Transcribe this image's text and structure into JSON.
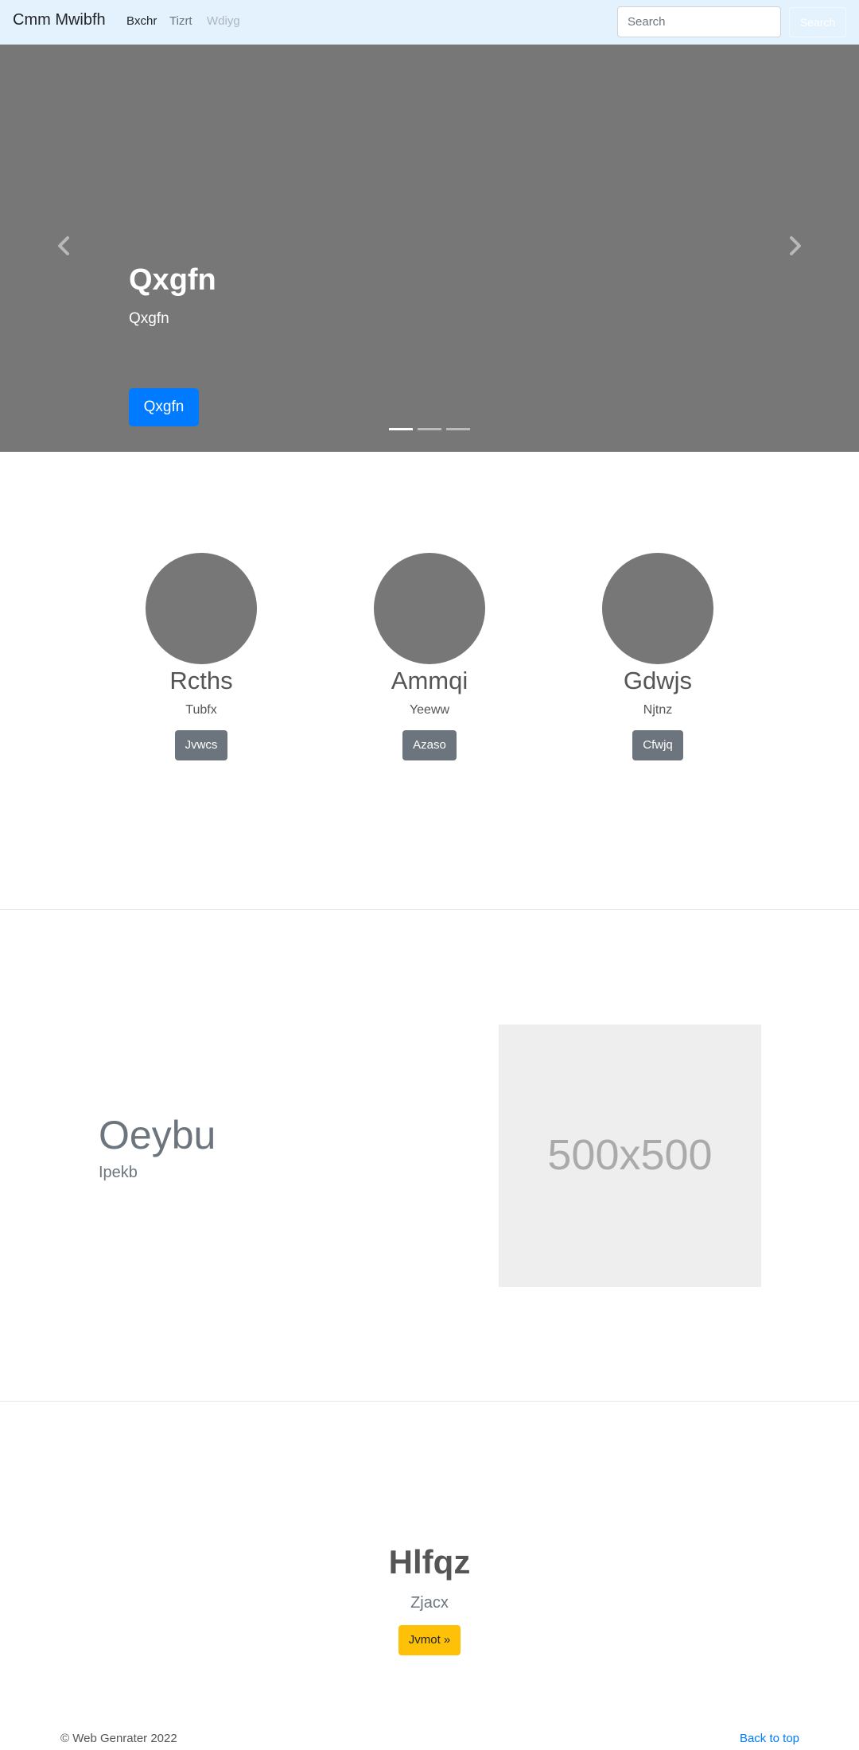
{
  "navbar": {
    "brand": "Cmm Mwibfh",
    "links": [
      {
        "label": "Bxchr",
        "state": "active"
      },
      {
        "label": "Tizrt",
        "state": "normal"
      },
      {
        "label": "Wdiyg",
        "state": "disabled"
      }
    ],
    "search_placeholder": "Search",
    "search_button": "Search"
  },
  "carousel": {
    "title": "Qxgfn",
    "subtitle": "Qxgfn",
    "button": "Qxgfn",
    "slide_count": 3,
    "active_slide": 1
  },
  "features": [
    {
      "title": "Rcths",
      "text": "Tubfx",
      "button": "Jvwcs"
    },
    {
      "title": "Ammqi",
      "text": "Yeeww",
      "button": "Azaso"
    },
    {
      "title": "Gdwjs",
      "text": "Njtnz",
      "button": "Cfwjq"
    }
  ],
  "featurette": {
    "heading": "Oeybu",
    "subheading": "Ipekb",
    "image_text": "500x500"
  },
  "jumbo": {
    "title": "Hlfqz",
    "subtitle": "Zjacx",
    "button": "Jvmot »"
  },
  "footer": {
    "copyright": "© Web Genrater 2022",
    "back_to_top": "Back to top"
  },
  "colors": {
    "navbar_bg": "#e3f2fd",
    "carousel_bg": "#777777",
    "primary": "#007bff",
    "secondary": "#6c757d",
    "warning": "#ffc107"
  }
}
